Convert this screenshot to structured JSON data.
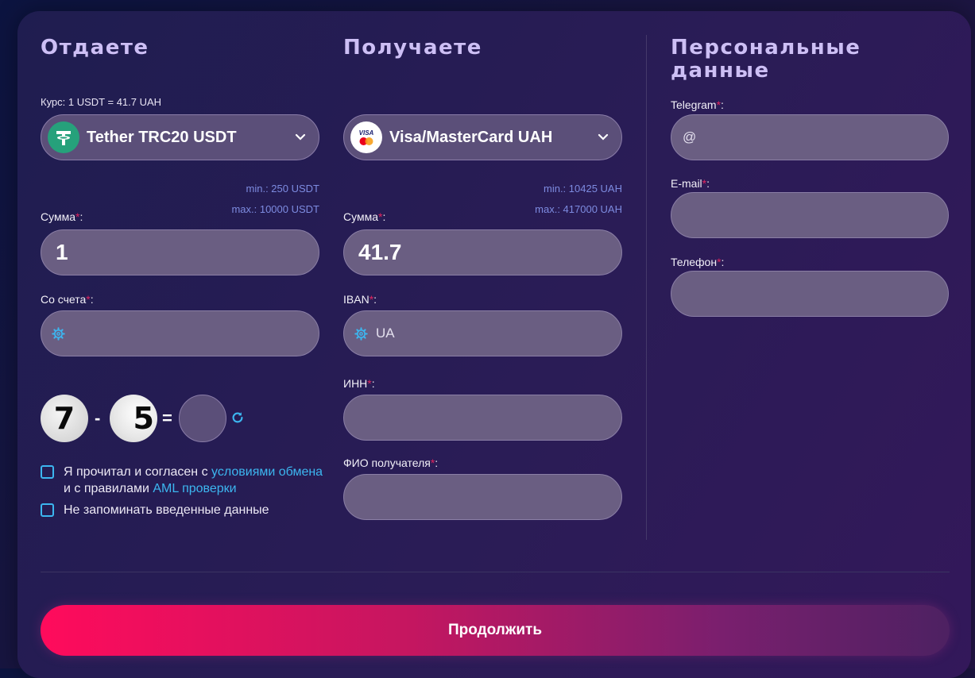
{
  "give": {
    "title": "Отдаете",
    "rate": "Курс: 1 USDT = 41.7 UAH",
    "currency": "Tether TRC20 USDT",
    "min": "min.: 250 USDT",
    "max": "max.: 10000 USDT",
    "amount_label": "Сумма",
    "amount_value": "1",
    "account_label": "Со счета",
    "account_value": ""
  },
  "receive": {
    "title": "Получаете",
    "currency": "Visa/MasterCard UAH",
    "min": "min.: 10425 UAH",
    "max": "max.: 417000 UAH",
    "amount_label": "Сумма",
    "amount_value": "41.7",
    "iban_label": "IBAN",
    "iban_value": "UA",
    "inn_label": "ИНН",
    "name_label": "ФИО получателя"
  },
  "personal": {
    "title_line1": "Персональные",
    "title_line2": "данные",
    "telegram_label": "Telegram",
    "telegram_value": "@",
    "email_label": "E-mail",
    "phone_label": "Телефон"
  },
  "required_mark": "*",
  "captcha": {
    "a": "7",
    "op": "-",
    "b": "5",
    "eq": "="
  },
  "agreement": {
    "text1": "Я прочитал и согласен с ",
    "link1": "условиями обмена",
    "text2": " и с правилами ",
    "link2": "AML проверки"
  },
  "remember": "Не запоминать введенные данные",
  "submit": "Продолжить",
  "colors": {
    "accent_link": "#3cb6f0",
    "required": "#e0245e",
    "button_start": "#ff0b5c",
    "button_end": "#4d2162"
  },
  "icons": {
    "give_currency": "tether-icon",
    "receive_currency": "visa-mastercard-icon",
    "dropdown": "chevron-down-icon",
    "field": "gear-icon",
    "refresh": "refresh-icon"
  }
}
